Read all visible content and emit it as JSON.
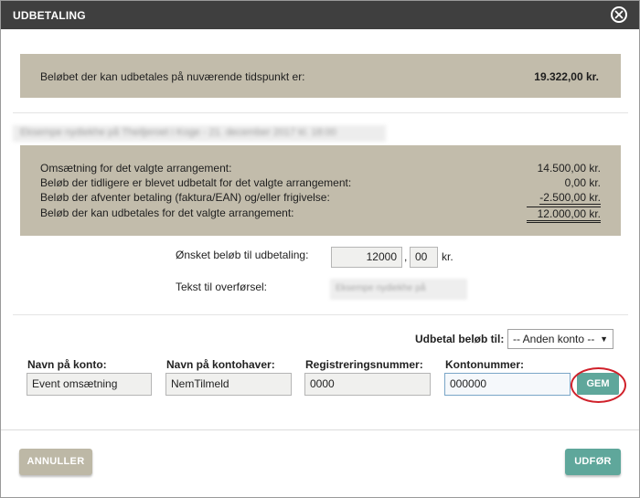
{
  "dialog": {
    "title": "UDBETALING",
    "close_icon": "close-circle-icon"
  },
  "summary": {
    "label": "Beløbet der kan udbetales på nuværende tidspunkt er:",
    "amount": "19.322,00 kr."
  },
  "arrangement": {
    "rows": [
      {
        "label": "Omsætning for det valgte arrangement:",
        "value": "14.500,00 kr."
      },
      {
        "label": "Beløb der tidligere er blevet udbetalt for det valgte arrangement:",
        "value": "0,00 kr."
      },
      {
        "label": "Beløb der afventer betaling (faktura/EAN) og/eller frigivelse:",
        "value": "-2.500,00 kr."
      },
      {
        "label": "Beløb der kan udbetales for det valgte arrangement:",
        "value": "12.000,00 kr."
      }
    ]
  },
  "payout_form": {
    "amount_label": "Ønsket beløb til udbetaling:",
    "amount_whole": "12000",
    "separator": ",",
    "amount_decimal": "00",
    "currency": "kr.",
    "transfer_text_label": "Tekst til overførsel:"
  },
  "destination": {
    "label": "Udbetal beløb til:",
    "selected": "-- Anden konto --"
  },
  "account": {
    "name_label": "Navn på konto:",
    "name_value": "Event omsætning",
    "holder_label": "Navn på kontohaver:",
    "holder_value": "NemTilmeld",
    "reg_label": "Registreringsnummer:",
    "reg_value": "0000",
    "account_label": "Kontonummer:",
    "account_value": "000000",
    "save_label": "GEM"
  },
  "footer": {
    "cancel_label": "ANNULLER",
    "execute_label": "UDFØR"
  },
  "colors": {
    "titlebar": "#3f3f3f",
    "panel": "#c2bcab",
    "teal_button": "#5fa79b",
    "annotation_circle": "#d0202a"
  }
}
